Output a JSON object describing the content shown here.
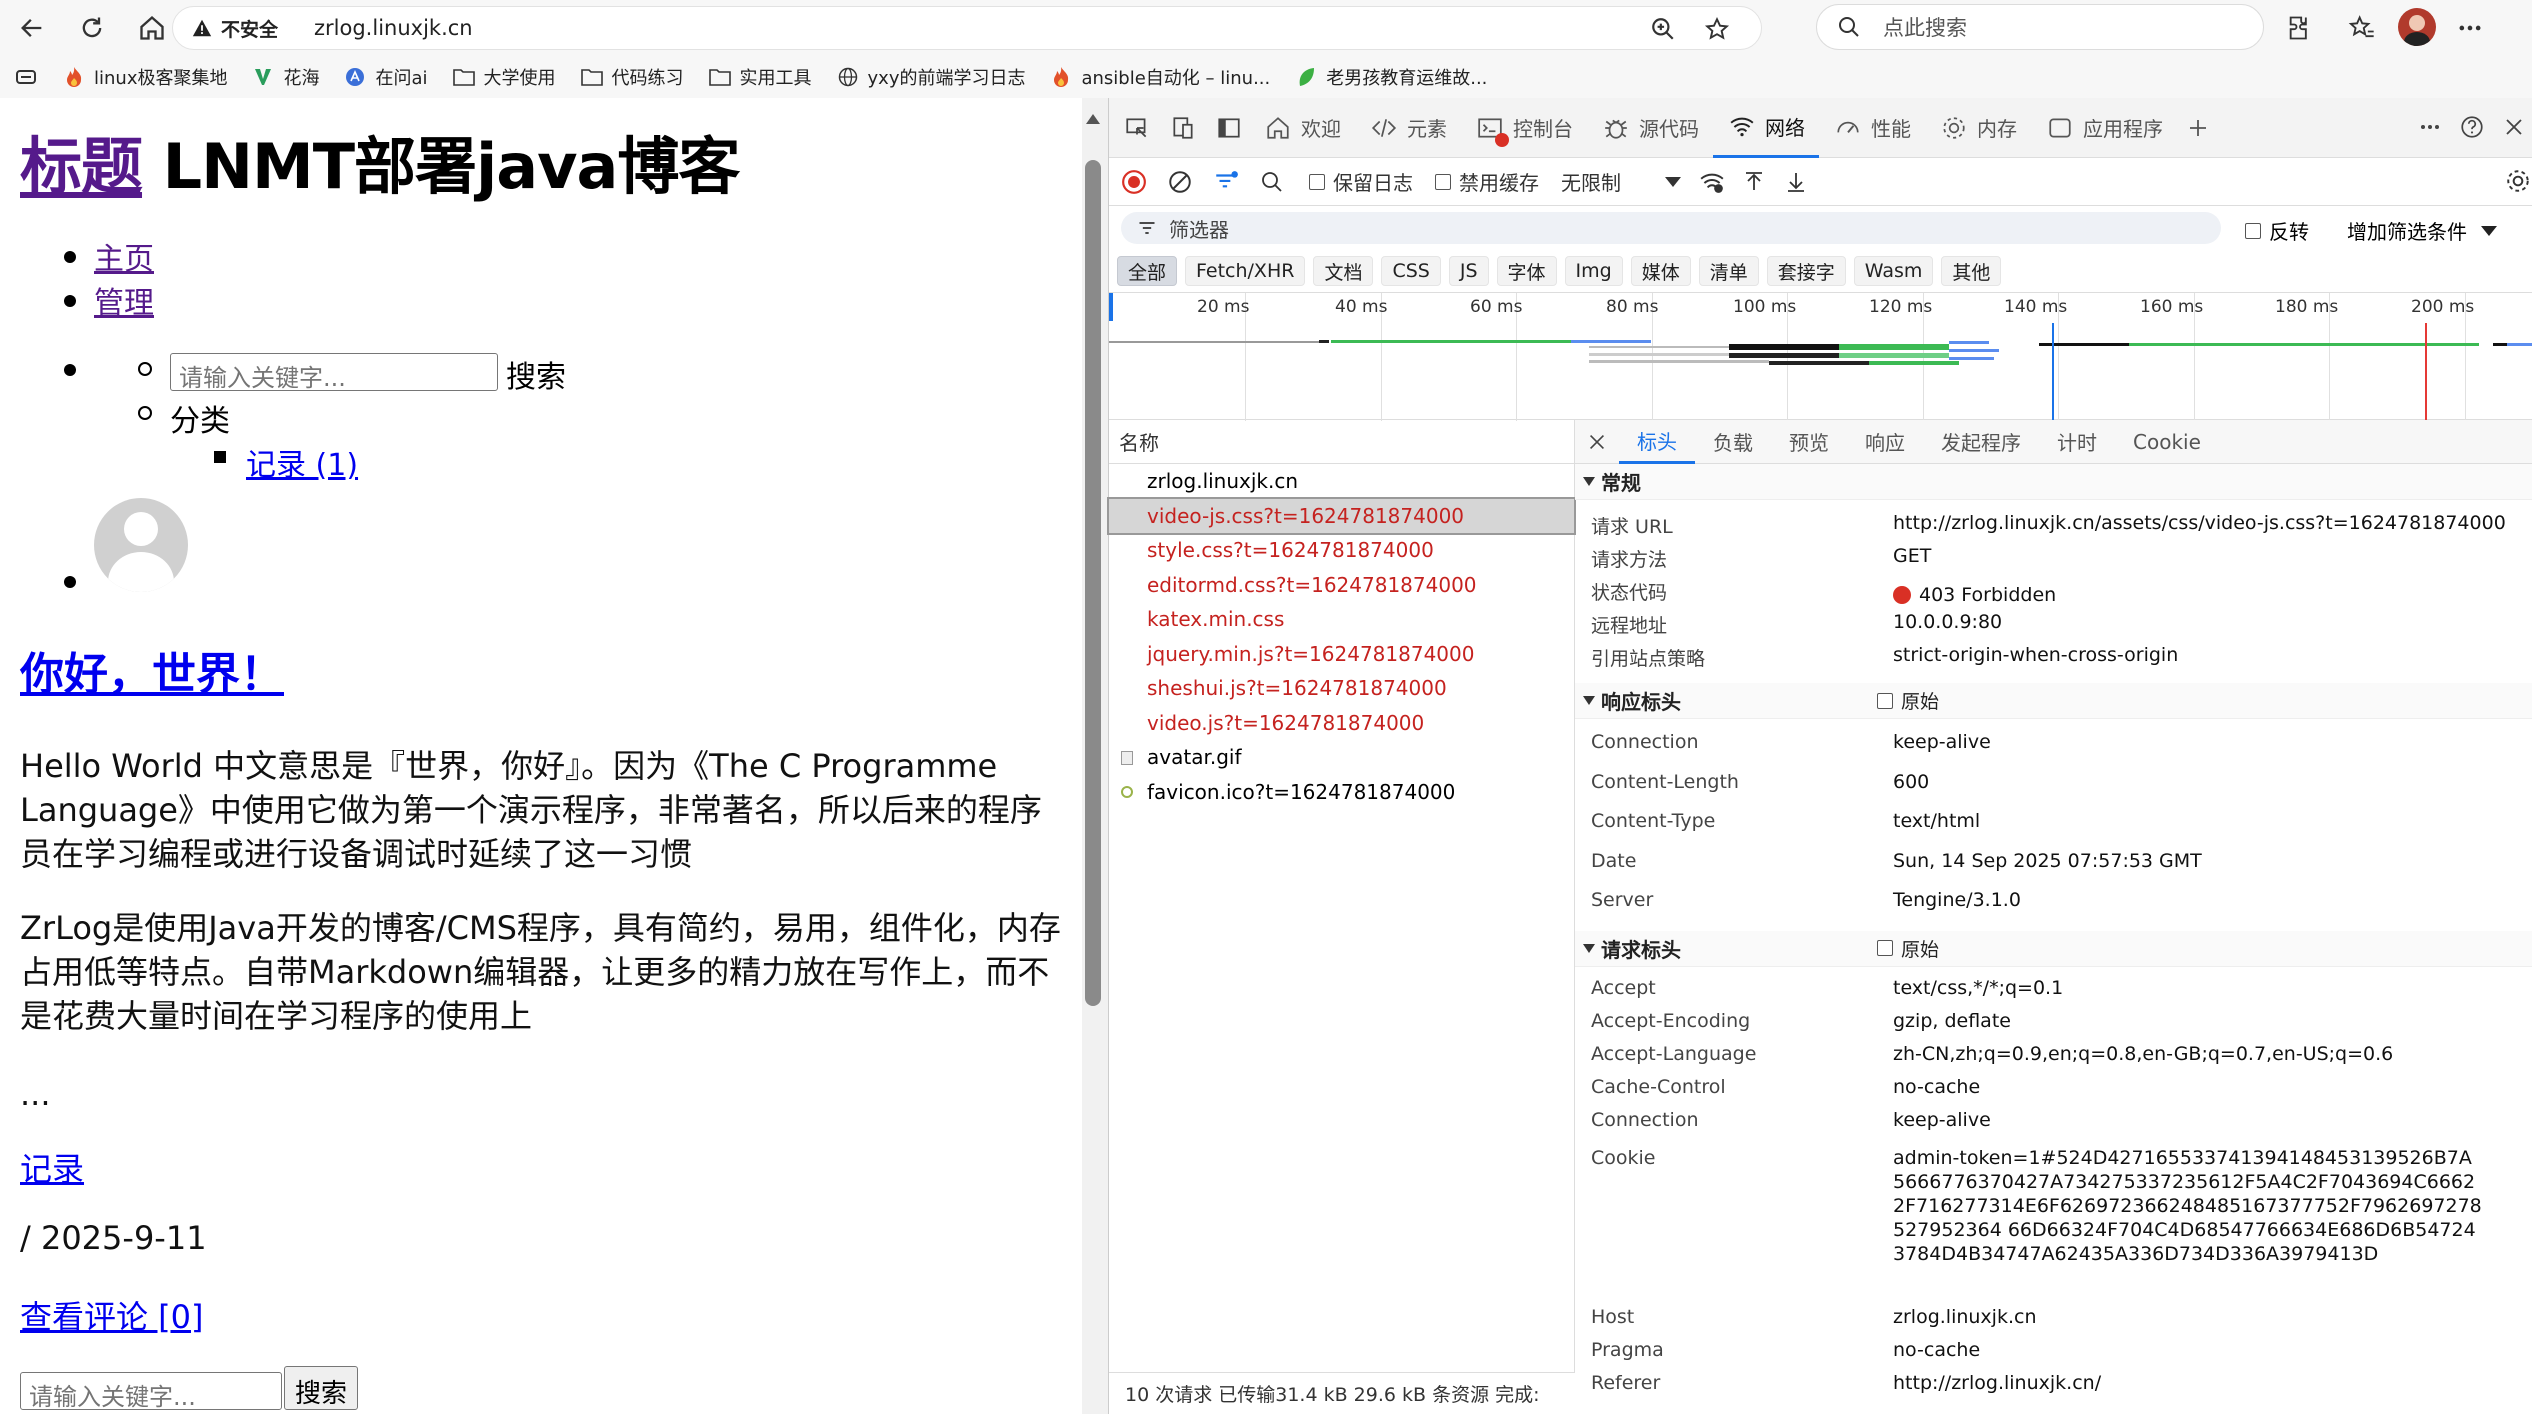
{
  "browser": {
    "insecure_label": "不安全",
    "url": "zrlog.linuxjk.cn",
    "search_placeholder": "点此搜索"
  },
  "bookmarks": [
    {
      "label": "linux极客聚集地",
      "icon": "flame-icon"
    },
    {
      "label": "花海",
      "icon": "v-logo-icon"
    },
    {
      "label": "在问ai",
      "icon": "ai-logo-icon"
    },
    {
      "label": "大学使用",
      "icon": "folder-icon"
    },
    {
      "label": "代码练习",
      "icon": "folder-icon"
    },
    {
      "label": "实用工具",
      "icon": "folder-icon"
    },
    {
      "label": "yxy的前端学习日志",
      "icon": "globe-icon"
    },
    {
      "label": "ansible自动化 – linu...",
      "icon": "flame-icon"
    },
    {
      "label": "老男孩教育运维故...",
      "icon": "leaf-icon"
    }
  ],
  "page": {
    "title_link": "标题",
    "title_rest": " LNMT部署java博客",
    "nav": [
      "主页",
      "管理"
    ],
    "search_placeholder": "请输入关键字...",
    "search_label": "搜索",
    "category_label": "分类",
    "category_item": "记录 (1)",
    "post_title": "你好，世界！",
    "para1": "Hello World 中文意思是『世界，你好』。因为《The C Programme Language》中使用它做为第一个演示程序，非常著名，所以后来的程序员在学习编程或进行设备调试时延续了这一习惯",
    "para2": "ZrLog是使用Java开发的博客/CMS程序，具有简约，易用，组件化，内存占用低等特点。自带Markdown编辑器，让更多的精力放在写作上，而不是花费大量时间在学习程序的使用上",
    "ellipsis": "...",
    "category_link": "记录",
    "date": "/  2025-9-11",
    "comments": "查看评论 [0]",
    "bottom_search_placeholder": "请输入关键字...",
    "bottom_search_button": "搜索"
  },
  "devtools": {
    "tabs": [
      "欢迎",
      "元素",
      "控制台",
      "源代码",
      "网络",
      "性能",
      "内存",
      "应用程序"
    ],
    "active_tab": "网络",
    "toolbar": {
      "preserve_log": "保留日志",
      "disable_cache": "禁用缓存",
      "throttle": "无限制"
    },
    "filter_placeholder": "筛选器",
    "invert": "反转",
    "more_filters": "增加筛选条件",
    "type_filters": [
      "全部",
      "Fetch/XHR",
      "文档",
      "CSS",
      "JS",
      "字体",
      "Img",
      "媒体",
      "清单",
      "套接字",
      "Wasm",
      "其他"
    ],
    "timeline_ticks": [
      "20 ms",
      "40 ms",
      "60 ms",
      "80 ms",
      "100 ms",
      "120 ms",
      "140 ms",
      "160 ms",
      "180 ms",
      "200 ms"
    ],
    "name_header": "名称",
    "requests": [
      {
        "name": "zrlog.linuxjk.cn",
        "status": "ok"
      },
      {
        "name": "video-js.css?t=1624781874000",
        "status": "error"
      },
      {
        "name": "style.css?t=1624781874000",
        "status": "error"
      },
      {
        "name": "editormd.css?t=1624781874000",
        "status": "error"
      },
      {
        "name": "katex.min.css",
        "status": "error"
      },
      {
        "name": "jquery.min.js?t=1624781874000",
        "status": "error"
      },
      {
        "name": "sheshui.js?t=1624781874000",
        "status": "error"
      },
      {
        "name": "video.js?t=1624781874000",
        "status": "error"
      },
      {
        "name": "avatar.gif",
        "status": "ok"
      },
      {
        "name": "favicon.ico?t=1624781874000",
        "status": "ok"
      }
    ],
    "status_bar": "10 次请求   已传输31.4 kB   29.6 kB 条资源   完成:",
    "detail_tabs": [
      "标头",
      "负载",
      "预览",
      "响应",
      "发起程序",
      "计时",
      "Cookie"
    ],
    "general_label": "常规",
    "general": [
      {
        "k": "请求 URL",
        "v": "http://zrlog.linuxjk.cn/assets/css/video-js.css?t=1624781874000"
      },
      {
        "k": "请求方法",
        "v": "GET"
      },
      {
        "k": "状态代码",
        "v": "403 Forbidden"
      },
      {
        "k": "远程地址",
        "v": "10.0.0.9:80"
      },
      {
        "k": "引用站点策略",
        "v": "strict-origin-when-cross-origin"
      }
    ],
    "response_label": "响应标头",
    "raw_label": "原始",
    "response_headers": [
      {
        "k": "Connection",
        "v": "keep-alive"
      },
      {
        "k": "Content-Length",
        "v": "600"
      },
      {
        "k": "Content-Type",
        "v": "text/html"
      },
      {
        "k": "Date",
        "v": "Sun, 14 Sep 2025 07:57:53 GMT"
      },
      {
        "k": "Server",
        "v": "Tengine/3.1.0"
      }
    ],
    "request_label": "请求标头",
    "request_headers": [
      {
        "k": "Accept",
        "v": "text/css,*/*;q=0.1"
      },
      {
        "k": "Accept-Encoding",
        "v": "gzip, deflate"
      },
      {
        "k": "Accept-Language",
        "v": "zh-CN,zh;q=0.9,en;q=0.8,en-GB;q=0.7,en-US;q=0.6"
      },
      {
        "k": "Cache-Control",
        "v": "no-cache"
      },
      {
        "k": "Connection",
        "v": "keep-alive"
      },
      {
        "k": "Cookie",
        "v": "admin-token=1#524D427165533741394148453139526B7A5666776370427A734275337235612F5A4C2F7043694C66622F716277314E6F626972366248485167377752F7962697278527952364 66D66324F704C4D68547766634E686D6B547243784D4B34747A62435A336D734D336A3979413D"
      },
      {
        "k": "Host",
        "v": "zrlog.linuxjk.cn"
      },
      {
        "k": "Pragma",
        "v": "no-cache"
      },
      {
        "k": "Referer",
        "v": "http://zrlog.linuxjk.cn/"
      }
    ],
    "status_dot_color": "#d93025"
  }
}
